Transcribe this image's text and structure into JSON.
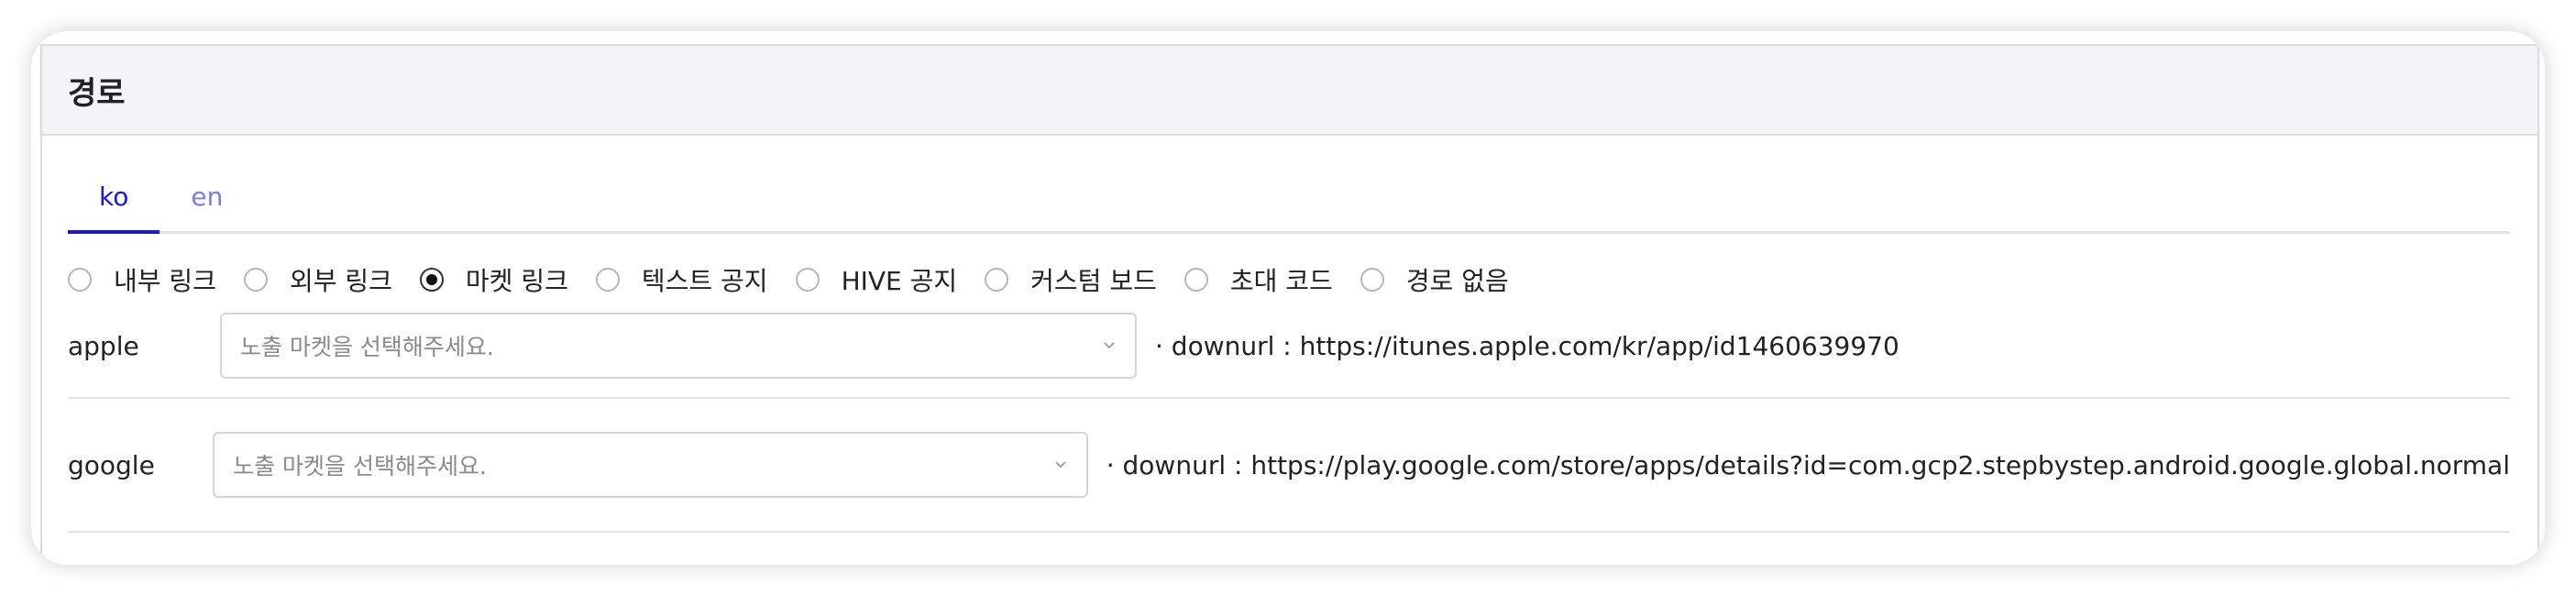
{
  "panel": {
    "title": "경로"
  },
  "tabs": [
    {
      "label": "ko",
      "active": true
    },
    {
      "label": "en",
      "active": false
    }
  ],
  "link_types": [
    {
      "label": "내부 링크",
      "checked": false
    },
    {
      "label": "외부 링크",
      "checked": false
    },
    {
      "label": "마켓 링크",
      "checked": true
    },
    {
      "label": "텍스트 공지",
      "checked": false
    },
    {
      "label": "HIVE 공지",
      "checked": false
    },
    {
      "label": "커스텀 보드",
      "checked": false
    },
    {
      "label": "초대 코드",
      "checked": false
    },
    {
      "label": "경로 없음",
      "checked": false
    }
  ],
  "markets": [
    {
      "name": "apple",
      "placeholder": "노출 마켓을 선택해주세요.",
      "downurl": "· downurl : https://itunes.apple.com/kr/app/id1460639970"
    },
    {
      "name": "google",
      "placeholder": "노출 마켓을 선택해주세요.",
      "downurl": "· downurl : https://play.google.com/store/apps/details?id=com.gcp2.stepbystep.android.google.global.normal"
    }
  ],
  "icons": {
    "select_chevron": "chevron-down-icon"
  },
  "colors": {
    "accent": "#1a1ad6",
    "inactive_tab": "#7a7fe8",
    "header_bg": "#f3f4f5"
  }
}
